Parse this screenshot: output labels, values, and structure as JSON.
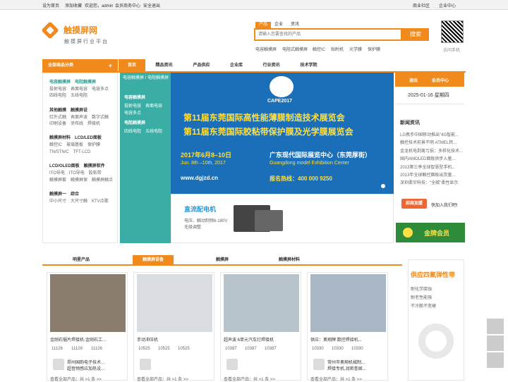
{
  "topbar": {
    "home": "设为首页",
    "fav": "添加收藏",
    "welcome": "欢迎您，admin",
    "member": "会员商务中心",
    "logout": "安全退出",
    "b1": "商业社区",
    "b2": "企业中心"
  },
  "logo": {
    "name": "触摸屏网",
    "slogan": "触摸屏行业平台"
  },
  "search": {
    "tabs": [
      "产品",
      "企业",
      "资讯"
    ],
    "placeholder": "请输入您要查找的产品",
    "button": "搜索",
    "hot": [
      "电容触摸屏",
      "电阻式触摸屏",
      "触控IC",
      "贴附机",
      "光学膜",
      "保护膜"
    ]
  },
  "qr": {
    "label": "访问手机"
  },
  "nav": {
    "all": "全部商品分类",
    "plus": "+",
    "items": [
      "首页",
      "精品资讯",
      "产品供应",
      "企业库",
      "行业资讯",
      "技术学院"
    ]
  },
  "sidebar": {
    "groups": [
      {
        "head": "电容触摸屏　电阻触摸屏",
        "links": [
          "投射电容　表面电容　电容多点",
          "四线电阻　五线电阻"
        ]
      },
      {
        "head": "其他触摸　触摸屏设",
        "links": [
          "红外式触　表面声波　数字式触",
          "印刷设备　涂布线　焊接机"
        ]
      },
      {
        "head": "触摸屏材料　LCD/LED面板",
        "links": [
          "触控IC　玻璃基板　保护膜",
          "TN/STN/C　TFT-LCD"
        ]
      },
      {
        "head": "LCD/OLED面板　触摸屏软件",
        "links": [
          "ITO导电　ITO导电　胶粘带",
          "触摸屏套　触摸屏保　触摸屏触点"
        ]
      },
      {
        "head": "触摸屏一　综合",
        "links": [
          "中小尺寸　大尺寸触　KTV点歌"
        ]
      }
    ]
  },
  "teal": {
    "title": "电容触摸屏 / 电阻触摸屏",
    "g1": "电容触摸屏",
    "g1a": "投射电容　表面电容",
    "g1b": "电容多点",
    "g2": "电阻触摸屏",
    "g2a": "四线电阻　五线电阻"
  },
  "banner": {
    "logo": "CAPE2017",
    "line1": "第11届东莞国际高性能薄膜制造技术展览会",
    "line2": "第11届东莞国际胶粘带保护膜及光学膜展览会",
    "date_cn": "2017年6月8–10日",
    "date_en": "Jun. 8th –10th, 2017",
    "venue_cn": "广东现代国际展览中心（东莞厚街）",
    "venue_en": "Guangdong model Exhibition Center",
    "web": "www.dgjzd.cn",
    "hotline": "报名热线：400 000 9250"
  },
  "subbanner": {
    "title": "直流配电机",
    "d1": "电压、触动制频6-180V",
    "d2": "无级调整"
  },
  "rpanel": {
    "exit": "退出",
    "member": "会员中心",
    "date": "2025-01-16 星期四",
    "news_title": "新闻资讯",
    "news": [
      "LG携手中国移动推出\"4G智能...",
      "触控技术前景不明 ATMEL转...",
      "金龙机电剥离亏损：多样化技术...",
      "国内AMOLED面板供步入量...",
      "2013第三季全球智慧型手机...",
      "2013年全球触控面板出货量...",
      "深圳柔宇科技：\"全碳\"柔性显示"
    ],
    "join_btn": "招商加盟",
    "join_text": "快加入我们吧!",
    "gold": "金牌会员"
  },
  "tabs": [
    "明星产品",
    "触摸屏设备",
    "触摸屏",
    "触摸屏材料"
  ],
  "cards": [
    {
      "title": "金刚石锯片焊接机-金刚石工...",
      "stats": [
        "11126",
        "11126",
        "11126"
      ],
      "company": [
        "郑州国韵电子技术...",
        "超音频感应加热设...",
        "查看全部产品：共"
      ],
      "more": "查看全部产品：共 >1 条 >>"
    },
    {
      "title": "手动冲压机",
      "stats": [
        "10525",
        "10525",
        "10525"
      ],
      "company": [
        "",
        ""
      ],
      "more": "查看全部产品：共 >1 条 >>"
    },
    {
      "title": "超声波 6单元汽车灯焊接机",
      "stats": [
        "10387",
        "10387",
        "10387"
      ],
      "company": [
        "",
        ""
      ],
      "more": "查看全部产品：共 >1 条 >>"
    },
    {
      "title": "供应：奥翔牌 数控焊接机...",
      "stats": [
        "10330",
        "10330",
        "10330"
      ],
      "company": [
        "常州市奥翔机械制...",
        "焊接专机,润密卷固..."
      ],
      "more": "查看全部产品：共 >1 条 >>"
    }
  ],
  "ad": {
    "title": "供应四氟弹性带",
    "l1": "耐化学腐蚀",
    "l2": "耐老性能强",
    "l3": "不冷脆不变硬"
  },
  "colors": {
    "accent": "#f08a1c",
    "teal": "#3aaea4",
    "banner": "#1a6fb8",
    "gold": "#fde046"
  }
}
